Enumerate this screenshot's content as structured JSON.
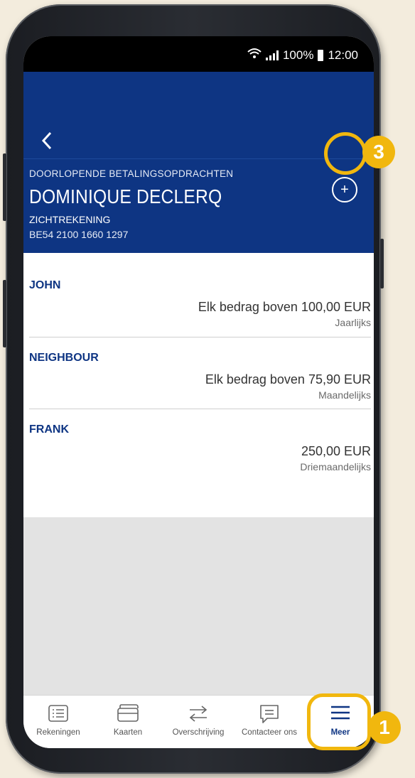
{
  "status_bar": {
    "battery": "100%",
    "time": "12:00"
  },
  "header": {
    "section_title": "DOORLOPENDE BETALINGSOPDRACHTEN",
    "account_holder": "DOMINIQUE DECLERQ",
    "account_type": "ZICHTREKENING",
    "iban": "BE54 2100 1660 1297",
    "add_button": "+"
  },
  "orders": [
    {
      "name": "JOHN",
      "amount": "Elk bedrag boven 100,00 EUR",
      "frequency": "Jaarlijks"
    },
    {
      "name": "NEIGHBOUR",
      "amount": "Elk bedrag boven 75,90 EUR",
      "frequency": "Maandelijks"
    },
    {
      "name": "FRANK",
      "amount": "250,00 EUR",
      "frequency": "Driemaandelijks"
    }
  ],
  "tabs": [
    {
      "label": "Rekeningen",
      "icon": "list-icon"
    },
    {
      "label": "Kaarten",
      "icon": "card-icon"
    },
    {
      "label": "Overschrijving",
      "icon": "transfer-icon"
    },
    {
      "label": "Contacteer ons",
      "icon": "chat-icon"
    },
    {
      "label": "Meer",
      "icon": "menu-icon",
      "active": true
    }
  ],
  "callouts": {
    "add": "3",
    "more": "1"
  },
  "colors": {
    "brand_blue": "#0e3583",
    "highlight": "#f1b70e"
  }
}
